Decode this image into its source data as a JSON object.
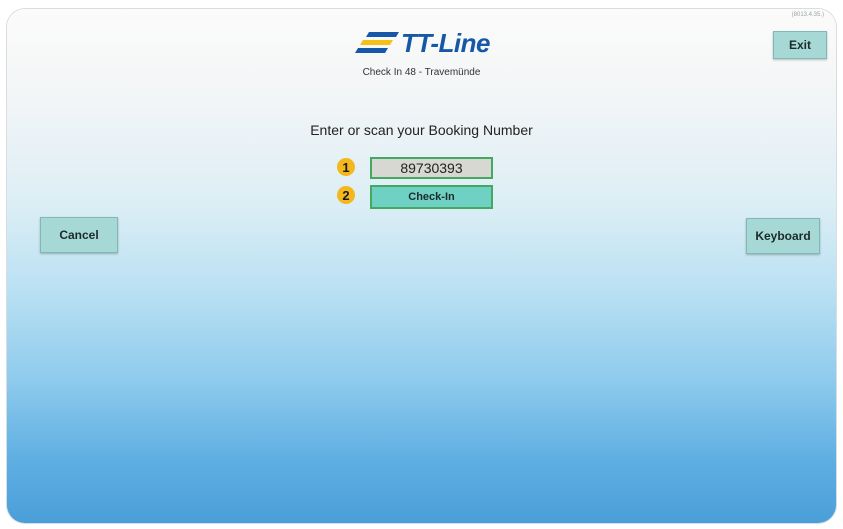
{
  "header": {
    "version": "(8013.4.35.)",
    "logo_text": "TT-Line",
    "subtitle": "Check In 48 - Travemünde"
  },
  "buttons": {
    "exit": "Exit",
    "cancel": "Cancel",
    "keyboard": "Keyboard",
    "checkin": "Check-In"
  },
  "main": {
    "prompt": "Enter or scan your Booking Number",
    "booking_number": "89730393",
    "markers": [
      "1",
      "2"
    ]
  },
  "colors": {
    "brand": "#1658a7",
    "button": "#a6d8d6",
    "checkin_button": "#6ed1c3",
    "input_border": "#43a862",
    "marker": "#f5b81c"
  }
}
